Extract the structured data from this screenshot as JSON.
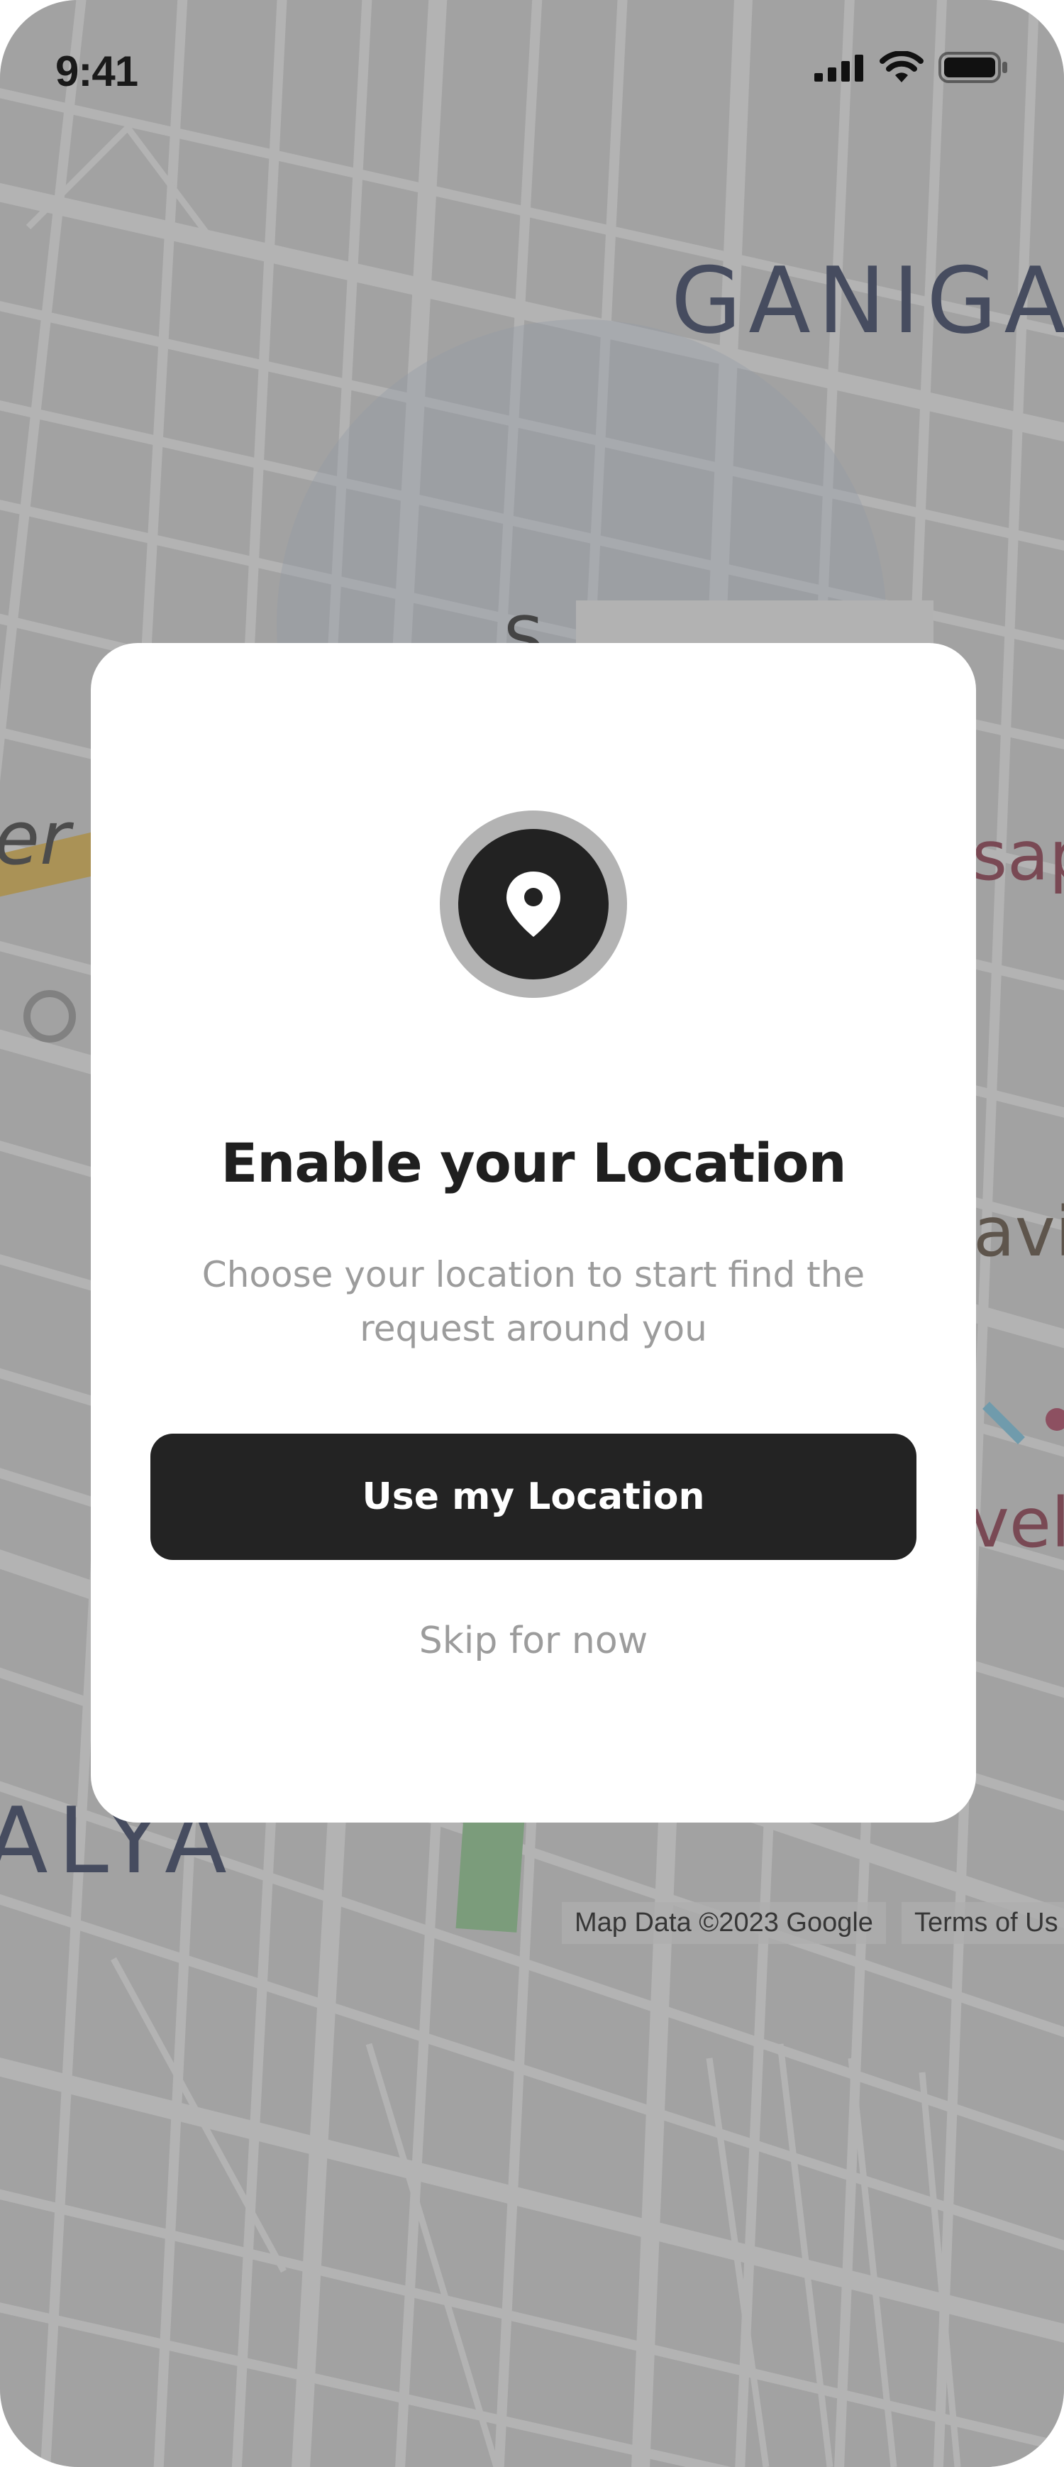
{
  "status_bar": {
    "time": "9:41",
    "icons": [
      "cellular-signal-icon",
      "wifi-icon",
      "battery-icon"
    ]
  },
  "map": {
    "labels": {
      "ganigar": "GANIGAR",
      "alya": "ALYA",
      "er": "er",
      "sap": "sap",
      "avi": "avi",
      "vel": "vel",
      "s": "S"
    },
    "attribution": {
      "map_data": "Map Data ©2023 Google",
      "terms": "Terms of Us"
    }
  },
  "dialog": {
    "icon": "location-pin-icon",
    "title": "Enable your Location",
    "subtitle": "Choose your location to start find the request around you",
    "primary_button": "Use my Location",
    "secondary_link": "Skip for now"
  },
  "colors": {
    "primary": "#232323",
    "muted_text": "#9c9c9c",
    "card_bg": "#ffffff",
    "pin_ring": "#b3b3b3"
  }
}
